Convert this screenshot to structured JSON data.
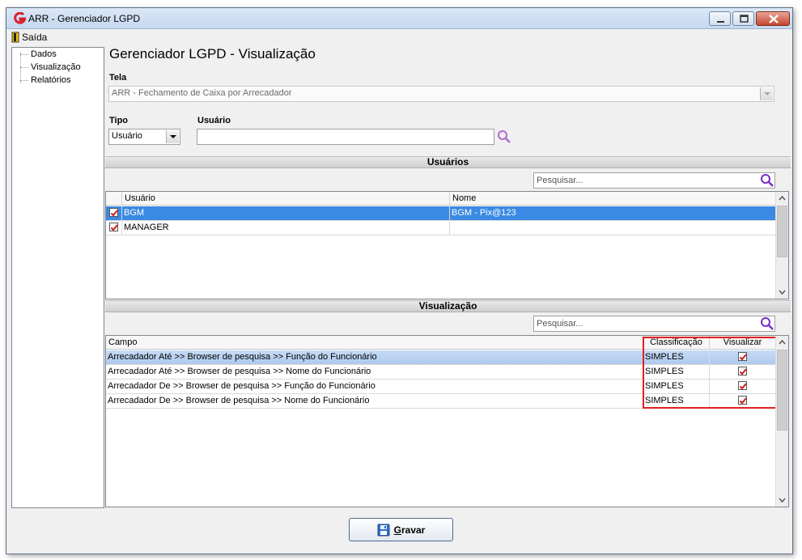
{
  "window": {
    "title": "ARR - Gerenciador LGPD"
  },
  "menu": {
    "saida": "Saída"
  },
  "tree": {
    "items": [
      "Dados",
      "Visualização",
      "Relatórios"
    ]
  },
  "main": {
    "title": "Gerenciador LGPD - Visualização"
  },
  "tela": {
    "label": "Tela",
    "value": "ARR - Fechamento de Caixa por Arrecadador"
  },
  "tipo": {
    "label": "Tipo",
    "value": "Usuário"
  },
  "usuario_field": {
    "label": "Usuário",
    "value": ""
  },
  "usuarios_section": {
    "title": "Usuários",
    "search_placeholder": "Pesquisar...",
    "columns": [
      "Usuário",
      "Nome"
    ],
    "rows": [
      {
        "checked": true,
        "usuario": "BGM",
        "nome": "BGM - Pix@123",
        "selected": true
      },
      {
        "checked": true,
        "usuario": "MANAGER",
        "nome": "",
        "selected": false
      }
    ]
  },
  "visualizacao_section": {
    "title": "Visualização",
    "search_placeholder": "Pesquisar...",
    "columns": [
      "Campo",
      "Classificação",
      "Visualizar"
    ],
    "rows": [
      {
        "campo": "Arrecadador Até >> Browser de pesquisa >> Função do Funcionário",
        "classificacao": "SIMPLES",
        "visualizar": true
      },
      {
        "campo": "Arrecadador Até >> Browser de pesquisa >> Nome do Funcionário",
        "classificacao": "SIMPLES",
        "visualizar": true
      },
      {
        "campo": "Arrecadador De >> Browser de pesquisa >> Função do Funcionário",
        "classificacao": "SIMPLES",
        "visualizar": true
      },
      {
        "campo": "Arrecadador De >> Browser de pesquisa >> Nome do Funcionário",
        "classificacao": "SIMPLES",
        "visualizar": true
      }
    ]
  },
  "buttons": {
    "gravar_first": "G",
    "gravar_rest": "ravar"
  },
  "colors": {
    "accent_red": "#e02020",
    "selection_blue": "#3a8ae3",
    "search_icon_purple": "#7a2bc9"
  }
}
